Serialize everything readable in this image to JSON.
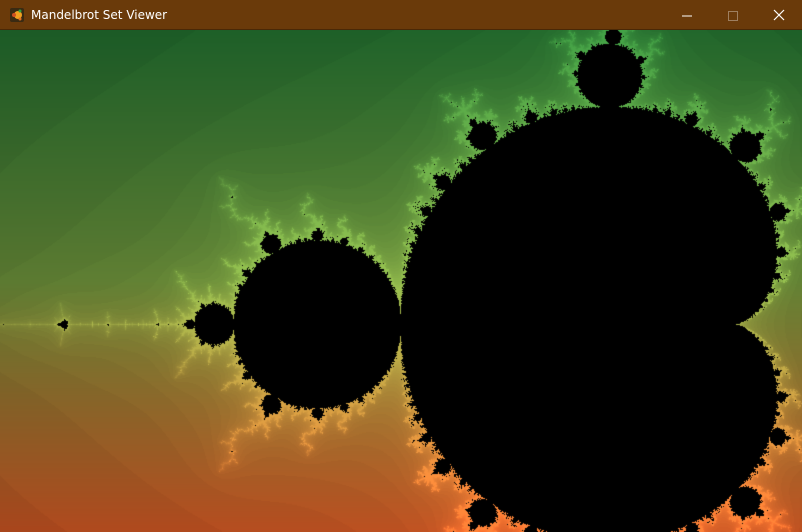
{
  "window": {
    "title": "Mandelbrot Set Viewer",
    "icon": "fractal-app-icon",
    "controls": {
      "minimize": "minimize-icon",
      "maximize": "maximize-icon",
      "close": "close-icon"
    },
    "colors": {
      "titlebar": "#6a3a0a",
      "text": "#ffffff"
    }
  },
  "viewer": {
    "set_color": "#000000",
    "gradient_top": "#1a7a32",
    "gradient_mid": "#6f9a3c",
    "gradient_bottom": "#f05a23"
  }
}
